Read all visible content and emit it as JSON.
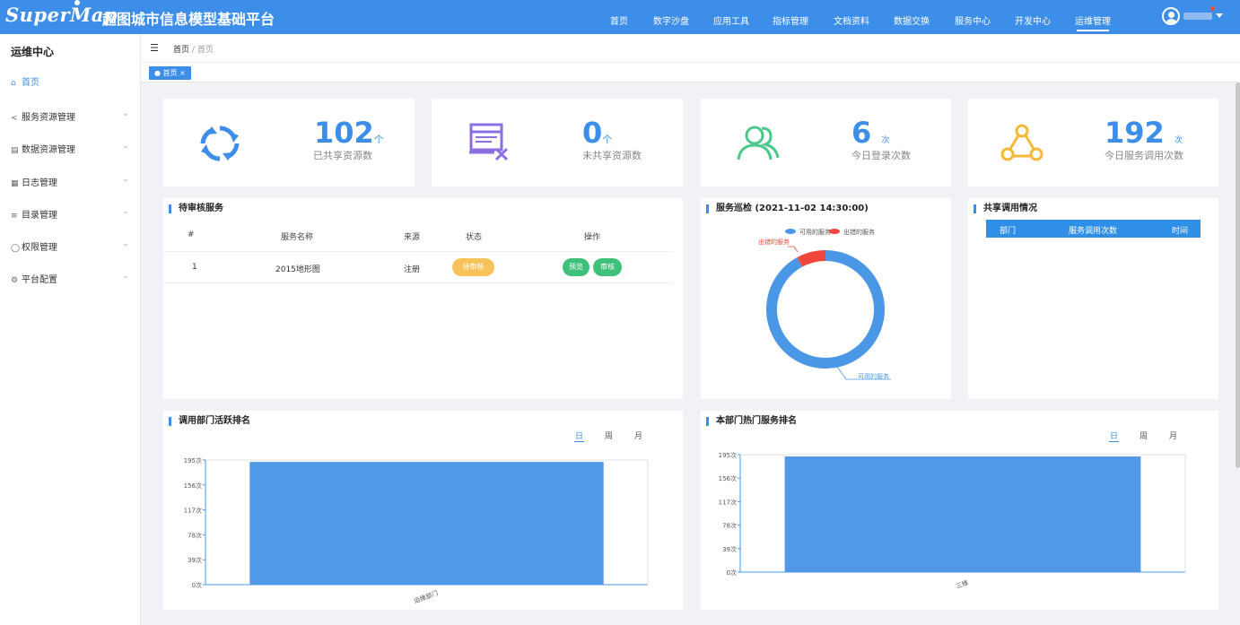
{
  "header": {
    "logo": "SuperMap",
    "title": "超图城市信息模型基础平台",
    "nav": [
      "首页",
      "数字沙盘",
      "应用工具",
      "指标管理",
      "文档资料",
      "数据交换",
      "服务中心",
      "开发中心",
      "运维管理"
    ],
    "active_nav": "运维管理"
  },
  "sidebar": {
    "title": "运维中心",
    "items": [
      {
        "label": "首页",
        "icon": "home-icon"
      },
      {
        "label": "服务资源管理",
        "icon": "share-icon"
      },
      {
        "label": "数据资源管理",
        "icon": "database-icon"
      },
      {
        "label": "日志管理",
        "icon": "log-icon"
      },
      {
        "label": "目录管理",
        "icon": "list-icon"
      },
      {
        "label": "权限管理",
        "icon": "user-icon"
      },
      {
        "label": "平台配置",
        "icon": "settings-icon"
      }
    ]
  },
  "breadcrumb": {
    "root": "首页",
    "sep": "/",
    "current": "首页"
  },
  "tabs": [
    {
      "label": "● 首页 ×"
    }
  ],
  "stats": [
    {
      "value": "102",
      "unit": "个",
      "label": "已共享资源数",
      "icon": "sync-icon",
      "color": "#3d8ee8"
    },
    {
      "value": "0",
      "unit": "个",
      "label": "未共享资源数",
      "icon": "unshared-icon",
      "color": "#8b6fe0"
    },
    {
      "value": "6",
      "unit": "次",
      "label": "今日登录次数",
      "icon": "users-icon",
      "color": "#4bc98c"
    },
    {
      "value": "192",
      "unit": "次",
      "label": "今日服务调用次数",
      "icon": "triangle-nodes-icon",
      "color": "#f5b938"
    }
  ],
  "pending": {
    "title": "待审核服务",
    "headers": [
      "#",
      "服务名称",
      "来源",
      "状态",
      "操作"
    ],
    "rows": [
      {
        "index": "1",
        "name": "2015地形图",
        "source": "注册",
        "status": "待审核",
        "actions": [
          "预览",
          "审核"
        ]
      }
    ]
  },
  "inspection": {
    "title": "服务巡检 (2021-11-02 14:30:00)",
    "legend": [
      "可用的服务",
      "出错的服务"
    ],
    "label_error": "出错的服务",
    "label_ok": "可用的服务"
  },
  "share_usage": {
    "title": "共享调用情况",
    "headers": [
      "部门",
      "服务调用次数",
      "时间"
    ]
  },
  "periods": [
    "日",
    "周",
    "月"
  ],
  "chart_data": [
    {
      "type": "pie",
      "title": "服务巡检 (2021-11-02 14:30:00)",
      "categories": [
        "可用的服务",
        "出错的服务"
      ],
      "values": [
        92,
        8
      ],
      "colors": [
        "#4a97e6",
        "#f0473c"
      ]
    },
    {
      "type": "bar",
      "title": "调用部门活跃排名",
      "categories": [
        "运维部门"
      ],
      "values": [
        192
      ],
      "yticks": [
        "0次",
        "39次",
        "78次",
        "117次",
        "156次",
        "195次"
      ],
      "ylim": [
        0,
        195
      ],
      "color": "#5199e7"
    },
    {
      "type": "bar",
      "title": "本部门热门服务排名",
      "categories": [
        "三维"
      ],
      "values": [
        192
      ],
      "yticks": [
        "0次",
        "39次",
        "78次",
        "117次",
        "156次",
        "195次"
      ],
      "ylim": [
        0,
        195
      ],
      "color": "#5199e7"
    }
  ]
}
